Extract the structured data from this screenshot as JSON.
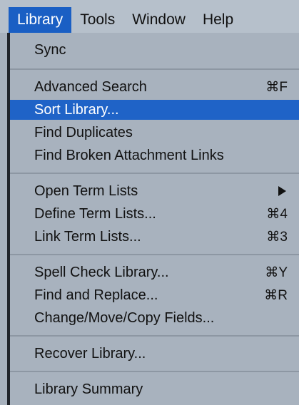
{
  "menubar": {
    "items": [
      {
        "label": "Library"
      },
      {
        "label": "Tools"
      },
      {
        "label": "Window"
      },
      {
        "label": "Help"
      }
    ]
  },
  "menu": {
    "sync": "Sync",
    "advanced_search": {
      "label": "Advanced Search",
      "shortcut": "⌘F"
    },
    "sort_library": "Sort Library...",
    "find_duplicates": "Find Duplicates",
    "find_broken_links": "Find Broken Attachment Links",
    "open_term_lists": "Open Term Lists",
    "define_term_lists": {
      "label": "Define Term Lists...",
      "shortcut": "⌘4"
    },
    "link_term_lists": {
      "label": "Link Term Lists...",
      "shortcut": "⌘3"
    },
    "spell_check": {
      "label": "Spell Check Library...",
      "shortcut": "⌘Y"
    },
    "find_replace": {
      "label": "Find and Replace...",
      "shortcut": "⌘R"
    },
    "change_fields": "Change/Move/Copy Fields...",
    "recover_library": "Recover Library...",
    "library_summary": "Library Summary"
  },
  "colors": {
    "highlight": "#1f63c7",
    "menu_background": "#a8b2be",
    "menubar_background": "#b6c0cb"
  }
}
